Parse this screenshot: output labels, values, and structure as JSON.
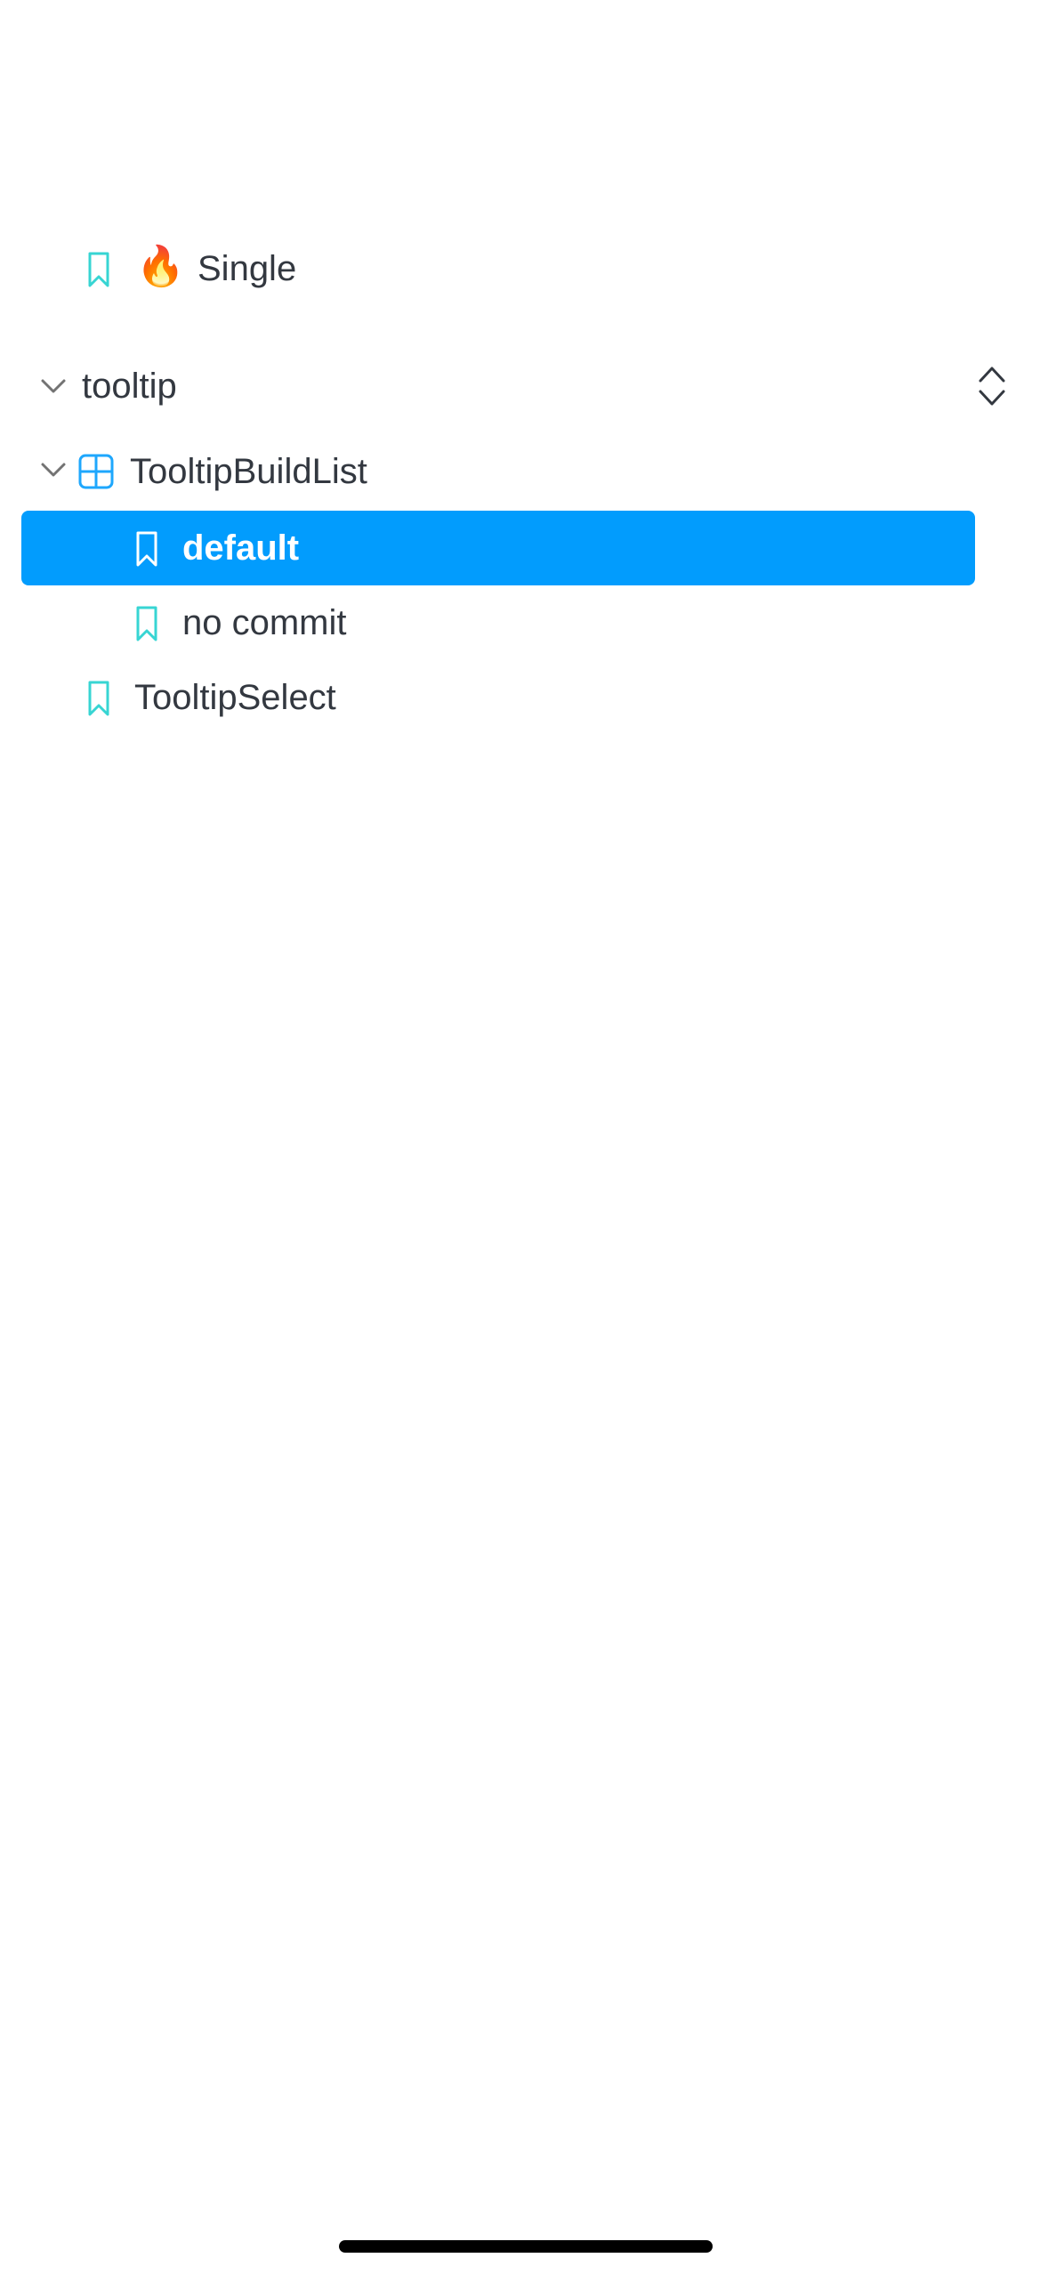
{
  "tree": {
    "story_single": {
      "emoji": "🔥",
      "label": "Single",
      "icon": "bookmark-icon"
    },
    "group_tooltip": {
      "label": "tooltip",
      "expanded": true,
      "action_icon": "expand-collapse-icon"
    },
    "component_tooltipbuildlist": {
      "label": "TooltipBuildList",
      "expanded": true,
      "icon": "component-icon"
    },
    "story_default": {
      "label": "default",
      "selected": true,
      "icon": "bookmark-icon"
    },
    "story_no_commit": {
      "label": "no commit",
      "icon": "bookmark-icon"
    },
    "story_tooltipselect": {
      "label": "TooltipSelect",
      "icon": "bookmark-icon"
    }
  },
  "colors": {
    "accent": "#029cfd",
    "story_icon": "#37d5d3",
    "component_icon": "#1ea7fd",
    "text": "#333840",
    "chevron": "#737373"
  }
}
